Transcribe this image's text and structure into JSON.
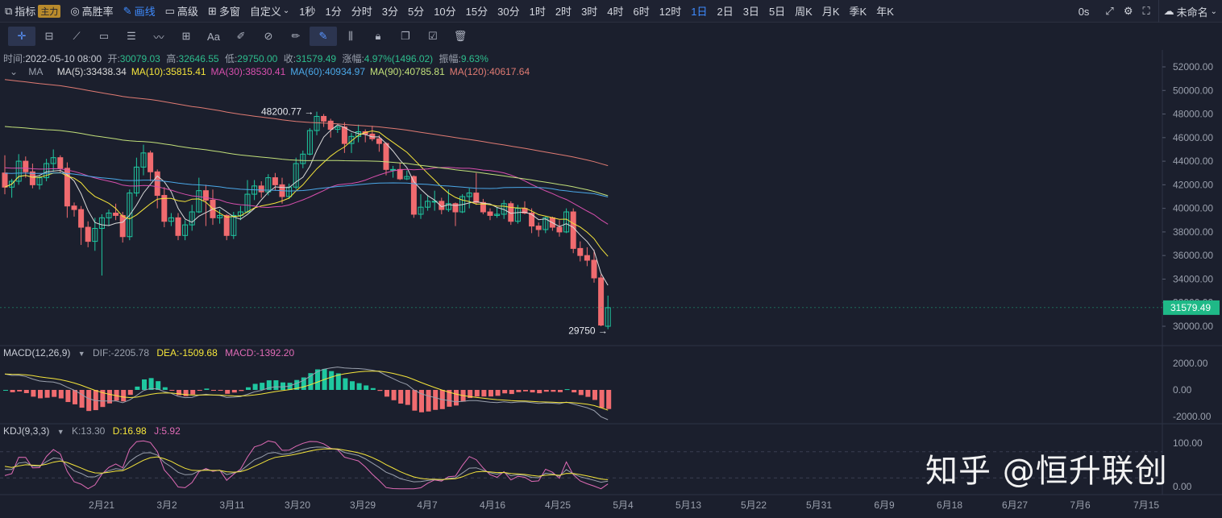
{
  "toolbar": {
    "items": [
      {
        "icon": "indicator-icon",
        "label": "指标",
        "tag": "主力"
      },
      {
        "icon": "target-icon",
        "label": "高胜率"
      },
      {
        "icon": "pen-icon",
        "label": "画线",
        "active": true
      },
      {
        "icon": "advanced-icon",
        "label": "高级"
      },
      {
        "icon": "grid-icon",
        "label": "多窗"
      },
      {
        "label": "自定义",
        "dropdown": true
      }
    ],
    "intervals": [
      "1秒",
      "1分",
      "分时",
      "3分",
      "5分",
      "10分",
      "15分",
      "30分",
      "1时",
      "2时",
      "3时",
      "4时",
      "6时",
      "12时",
      "1日",
      "2日",
      "3日",
      "5日",
      "周K",
      "月K",
      "季K",
      "年K"
    ],
    "active_interval": "1日",
    "latency": "0s",
    "layout_name": "未命名"
  },
  "drawing_tools": [
    "crosshair-icon",
    "ruler-icon",
    "trendline-icon",
    "rectangle-icon",
    "parallel-lines-icon",
    "wave-icon",
    "measure-icon",
    "text-icon",
    "brush-icon",
    "eraser-icon",
    "pencil-icon",
    "draw-mode-icon",
    "candles-icon",
    "lock-icon",
    "copy-icon",
    "settings-icon",
    "delete-icon"
  ],
  "drawing_text_tool_label": "Aa",
  "info": {
    "time_label": "时间:",
    "time": "2022-05-10 08:00",
    "open_label": "开:",
    "open": "30079.03",
    "high_label": "高:",
    "high": "32646.55",
    "low_label": "低:",
    "low": "29750.00",
    "close_label": "收:",
    "close": "31579.49",
    "change_label": "涨幅:",
    "change": "4.97%(1496.02)",
    "amplitude_label": "振幅:",
    "amplitude": "9.63%"
  },
  "ma": {
    "label": "MA",
    "items": [
      {
        "text": "MA(5):33438.34",
        "color": "#d9d9d9"
      },
      {
        "text": "MA(10):35815.41",
        "color": "#f5e53b"
      },
      {
        "text": "MA(30):38530.41",
        "color": "#d84fae"
      },
      {
        "text": "MA(60):40934.97",
        "color": "#4ba8e8"
      },
      {
        "text": "MA(90):40785.81",
        "color": "#c2e07a"
      },
      {
        "text": "MA(120):40617.64",
        "color": "#e07b73"
      }
    ]
  },
  "macd": {
    "label": "MACD(12,26,9)",
    "dif": "DIF:-2205.78",
    "dea": "DEA:-1509.68",
    "macd": "MACD:-1392.20"
  },
  "kdj": {
    "label": "KDJ(9,3,3)",
    "k": "K:13.30",
    "d": "D:16.98",
    "j": "J:5.92"
  },
  "price_axis": [
    "52000.00",
    "50000.00",
    "48000.00",
    "46000.00",
    "44000.00",
    "42000.00",
    "40000.00",
    "38000.00",
    "36000.00",
    "34000.00",
    "32000.00",
    "30000.00"
  ],
  "macd_axis": [
    "2000.00",
    "0.00",
    "-2000.00"
  ],
  "kdj_axis": [
    "100.00",
    "0.00"
  ],
  "current_price": "31579.49",
  "high_marker": "48200.77",
  "low_marker": "29750",
  "x_axis": [
    "2月21",
    "3月2",
    "3月11",
    "3月20",
    "3月29",
    "4月7",
    "4月16",
    "4月25",
    "5月4",
    "5月13",
    "5月22",
    "5月31",
    "6月9",
    "6月18",
    "6月27",
    "7月6",
    "7月15"
  ],
  "watermark": "知乎 @恒升联创",
  "colors": {
    "up": "#1fc7a0",
    "down": "#f06b6f",
    "accent": "#3f8cff",
    "price_tag": "#1fb987"
  },
  "chart_data": {
    "type": "candlestick",
    "ylim": [
      29000,
      53000
    ],
    "candles": [
      [
        43000,
        44500,
        41200,
        41800
      ],
      [
        41800,
        42500,
        40900,
        42300
      ],
      [
        42300,
        44600,
        42000,
        44000
      ],
      [
        44000,
        44400,
        42600,
        43100
      ],
      [
        43100,
        43800,
        41700,
        42000
      ],
      [
        42000,
        42800,
        41600,
        42600
      ],
      [
        42600,
        44200,
        42300,
        43800
      ],
      [
        43800,
        45000,
        43100,
        44300
      ],
      [
        44300,
        44500,
        43000,
        43400
      ],
      [
        43400,
        43900,
        39200,
        40200
      ],
      [
        40200,
        40500,
        39300,
        39900
      ],
      [
        39900,
        40200,
        36900,
        38400
      ],
      [
        38400,
        38900,
        36700,
        37200
      ],
      [
        37200,
        39200,
        36400,
        38300
      ],
      [
        38300,
        39500,
        34300,
        39200
      ],
      [
        39200,
        39900,
        38500,
        39600
      ],
      [
        39600,
        40400,
        39000,
        39400
      ],
      [
        39400,
        39700,
        37100,
        37600
      ],
      [
        37600,
        41600,
        37300,
        41300
      ],
      [
        41300,
        44300,
        41000,
        43500
      ],
      [
        43500,
        45400,
        42800,
        44700
      ],
      [
        44700,
        44900,
        42300,
        43100
      ],
      [
        43100,
        43300,
        40000,
        41100
      ],
      [
        41100,
        41800,
        38400,
        38900
      ],
      [
        38900,
        39600,
        38500,
        39200
      ],
      [
        39200,
        39600,
        37300,
        37700
      ],
      [
        37700,
        39000,
        37300,
        38600
      ],
      [
        38600,
        40300,
        38100,
        39700
      ],
      [
        39700,
        42600,
        39600,
        41500
      ],
      [
        41500,
        42000,
        38500,
        40700
      ],
      [
        40700,
        41600,
        38600,
        39200
      ],
      [
        39200,
        39900,
        38700,
        39400
      ],
      [
        39400,
        39500,
        37300,
        37700
      ],
      [
        37700,
        39700,
        37400,
        39400
      ],
      [
        39400,
        40200,
        39000,
        39700
      ],
      [
        39700,
        42400,
        39600,
        41200
      ],
      [
        41200,
        42400,
        40700,
        41900
      ],
      [
        41900,
        42300,
        40900,
        41400
      ],
      [
        41400,
        42900,
        41100,
        42600
      ],
      [
        42600,
        43000,
        41500,
        42000
      ],
      [
        42000,
        42600,
        40400,
        41000
      ],
      [
        41000,
        42100,
        40800,
        41800
      ],
      [
        41800,
        44300,
        41600,
        43800
      ],
      [
        43800,
        44900,
        43400,
        44600
      ],
      [
        44600,
        46800,
        44500,
        46600
      ],
      [
        46600,
        48200,
        46200,
        47800
      ],
      [
        47800,
        48000,
        46900,
        47400
      ],
      [
        47400,
        47600,
        46000,
        46700
      ],
      [
        46700,
        47000,
        46400,
        46900
      ],
      [
        46900,
        47300,
        44700,
        45500
      ],
      [
        45500,
        46400,
        44700,
        46100
      ],
      [
        46100,
        47100,
        45600,
        46500
      ],
      [
        46500,
        46700,
        45600,
        46300
      ],
      [
        46300,
        47000,
        45700,
        45900
      ],
      [
        45900,
        46200,
        44800,
        45500
      ],
      [
        45500,
        45600,
        42800,
        43300
      ],
      [
        43300,
        43600,
        42600,
        43300
      ],
      [
        43300,
        43900,
        42400,
        42500
      ],
      [
        42500,
        43200,
        42400,
        42700
      ],
      [
        42700,
        42800,
        39200,
        39500
      ],
      [
        39500,
        41200,
        39100,
        40100
      ],
      [
        40100,
        41100,
        39800,
        40600
      ],
      [
        40600,
        41500,
        39800,
        40600
      ],
      [
        40600,
        40900,
        39500,
        39900
      ],
      [
        39900,
        41600,
        39700,
        40400
      ],
      [
        40400,
        40500,
        38500,
        39700
      ],
      [
        39700,
        41200,
        39600,
        41000
      ],
      [
        41000,
        41700,
        40000,
        41300
      ],
      [
        41300,
        43000,
        40300,
        40500
      ],
      [
        40500,
        40800,
        39500,
        39700
      ],
      [
        39700,
        40000,
        39000,
        39400
      ],
      [
        39400,
        40100,
        39200,
        39500
      ],
      [
        39500,
        40700,
        39100,
        40400
      ],
      [
        40400,
        40600,
        38600,
        38900
      ],
      [
        38900,
        40300,
        38700,
        40000
      ],
      [
        40000,
        40600,
        39500,
        39600
      ],
      [
        39600,
        40000,
        37900,
        38500
      ],
      [
        38500,
        38800,
        37600,
        38200
      ],
      [
        38200,
        39300,
        37900,
        39200
      ],
      [
        39200,
        39300,
        38100,
        38400
      ],
      [
        38400,
        39000,
        37600,
        38000
      ],
      [
        38000,
        40000,
        37900,
        39700
      ],
      [
        39700,
        40000,
        36200,
        36600
      ],
      [
        36600,
        37200,
        35500,
        36000
      ],
      [
        36000,
        36700,
        35100,
        35600
      ],
      [
        35600,
        36500,
        33700,
        34100
      ],
      [
        34100,
        34400,
        30000,
        30100
      ],
      [
        30000,
        32600,
        29750,
        31580
      ]
    ],
    "x_labels": [
      "2月21",
      "3月2",
      "3月11",
      "3月20",
      "3月29",
      "4月7",
      "4月16",
      "4月25",
      "5月4",
      "5月13",
      "5月22",
      "5月31",
      "6月9",
      "6月18",
      "6月27",
      "7月6",
      "7月15"
    ]
  }
}
